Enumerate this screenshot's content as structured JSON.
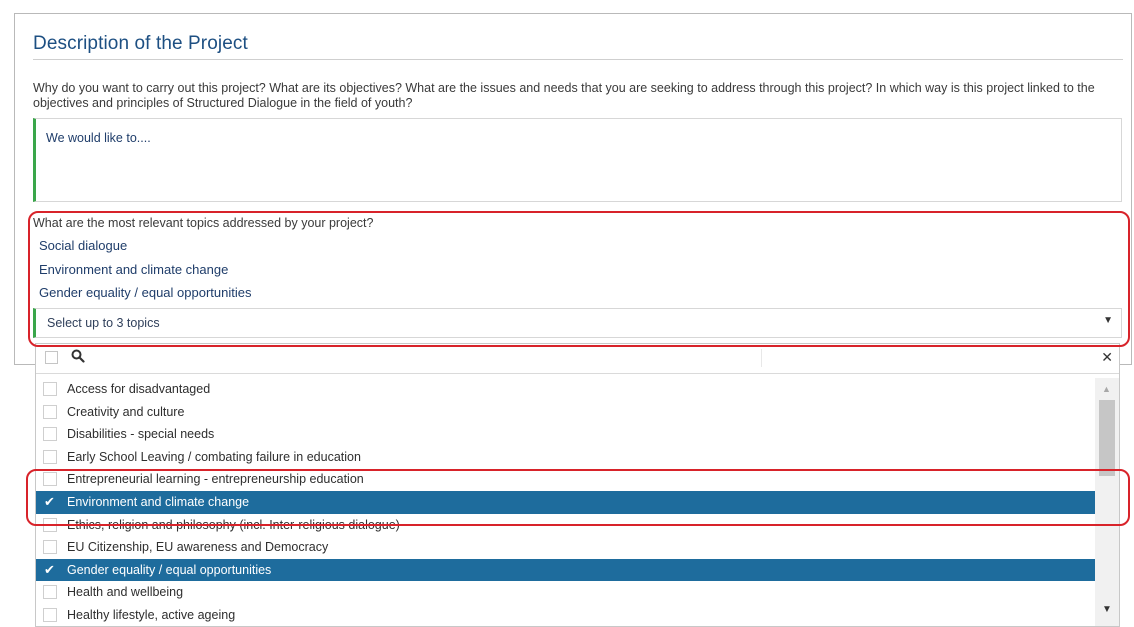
{
  "section": {
    "title": "Description of the Project"
  },
  "objectives": {
    "question": "Why do you want to carry out this project? What are its objectives? What are the issues and needs that you are seeking to address through this project? In which way is this project linked to the objectives and principles of Structured Dialogue in the field of youth?",
    "value": "We would like to...."
  },
  "topics": {
    "question": "What are the most relevant topics addressed by your project?",
    "selected": [
      "Social dialogue",
      "Environment and climate change",
      "Gender equality / equal opportunities"
    ],
    "placeholder": "Select up to 3 topics"
  },
  "dropdown": {
    "search_value": "",
    "options": [
      {
        "label": "Access for disadvantaged",
        "checked": false
      },
      {
        "label": "Creativity and culture",
        "checked": false
      },
      {
        "label": "Disabilities - special needs",
        "checked": false
      },
      {
        "label": "Early School Leaving / combating failure in education",
        "checked": false
      },
      {
        "label": "Entrepreneurial learning - entrepreneurship education",
        "checked": false
      },
      {
        "label": "Environment and climate change",
        "checked": true
      },
      {
        "label": "Ethics, religion and philosophy (incl. Inter-religious dialogue)",
        "checked": false
      },
      {
        "label": "EU Citizenship, EU awareness and Democracy",
        "checked": false
      },
      {
        "label": "Gender equality / equal opportunities",
        "checked": true
      },
      {
        "label": "Health and wellbeing",
        "checked": false
      },
      {
        "label": "Healthy lifestyle, active ageing",
        "checked": false
      }
    ]
  },
  "colors": {
    "accent_green": "#3aa64a",
    "selected_row": "#1e6c9d",
    "title_blue": "#1d4f82",
    "annotation_red": "#d8232a"
  },
  "icons": {
    "search": "search-icon",
    "close": "close-icon",
    "caret": "chevron-down-icon",
    "check": "check-icon"
  }
}
